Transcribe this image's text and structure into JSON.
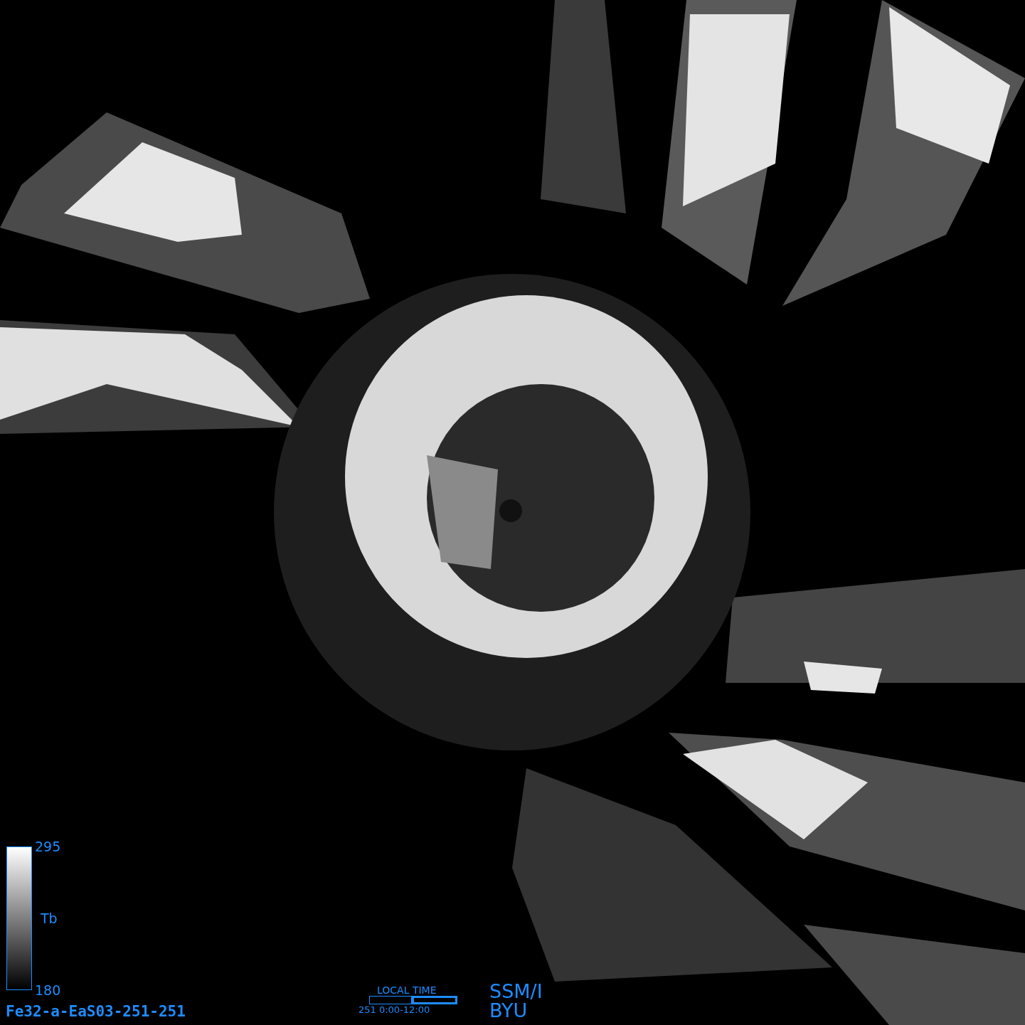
{
  "colorbar": {
    "max_label": "295",
    "quantity": "Tb",
    "min_label": "180"
  },
  "product_id": "Fe32-a-EaS03-251-251",
  "local_time": {
    "label": "LOCAL TIME",
    "segments": [
      {
        "selected": false
      },
      {
        "selected": true
      }
    ],
    "range": "251 0:00-12:00"
  },
  "credit": {
    "sensor": "SSM/I",
    "institution": "BYU"
  }
}
